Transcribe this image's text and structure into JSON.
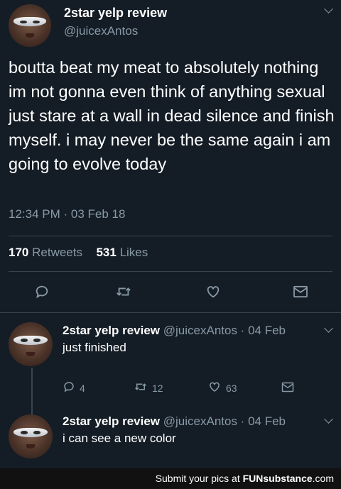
{
  "tweet": {
    "display_name": "2star yelp review",
    "handle": "@juicexAntos",
    "text": "boutta beat my meat to absolutely nothing im not gonna even think of anything sexual just stare at a wall in dead silence and finish myself. i may never be the same again i am going to evolve today",
    "timestamp": "12:34 PM · 03 Feb 18",
    "retweets_count": "170",
    "retweets_label": "Retweets",
    "likes_count": "531",
    "likes_label": "Likes"
  },
  "replies": [
    {
      "display_name": "2star yelp review",
      "meta": "@juicexAntos · 04 Feb",
      "text": "just finished",
      "reply_count": "4",
      "retweet_count": "12",
      "like_count": "63"
    },
    {
      "display_name": "2star yelp review",
      "meta": "@juicexAntos · 04 Feb",
      "text": "i can see a new color"
    }
  ],
  "footer": {
    "prefix": "Submit your pics at ",
    "brand": "FUNsubstance",
    "suffix": ".com"
  },
  "colors": {
    "background": "#141d26",
    "muted": "#8899a6",
    "divider": "#38444d"
  }
}
